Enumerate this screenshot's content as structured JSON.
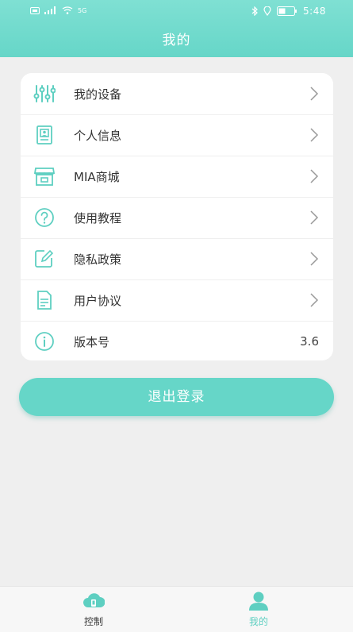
{
  "statusbar": {
    "time": "5:48",
    "signal_text": "4G",
    "data_text": "5G"
  },
  "header": {
    "title": "我的"
  },
  "menu": {
    "items": [
      {
        "label": "我的设备",
        "icon": "sliders-icon"
      },
      {
        "label": "个人信息",
        "icon": "profile-card-icon"
      },
      {
        "label": "MIA商城",
        "icon": "store-icon"
      },
      {
        "label": "使用教程",
        "icon": "help-icon"
      },
      {
        "label": "隐私政策",
        "icon": "edit-icon"
      },
      {
        "label": "用户协议",
        "icon": "document-icon"
      },
      {
        "label": "版本号",
        "icon": "info-icon",
        "value": "3.6"
      }
    ]
  },
  "logout": {
    "label": "退出登录"
  },
  "tabbar": {
    "tabs": [
      {
        "label": "控制",
        "icon": "cloud-device-icon",
        "active": false
      },
      {
        "label": "我的",
        "icon": "user-icon",
        "active": true
      }
    ]
  },
  "colors": {
    "accent": "#66d6c8",
    "icon": "#5ecfc1",
    "active_tab": "#5ecfc1",
    "inactive_tab": "#333333"
  }
}
